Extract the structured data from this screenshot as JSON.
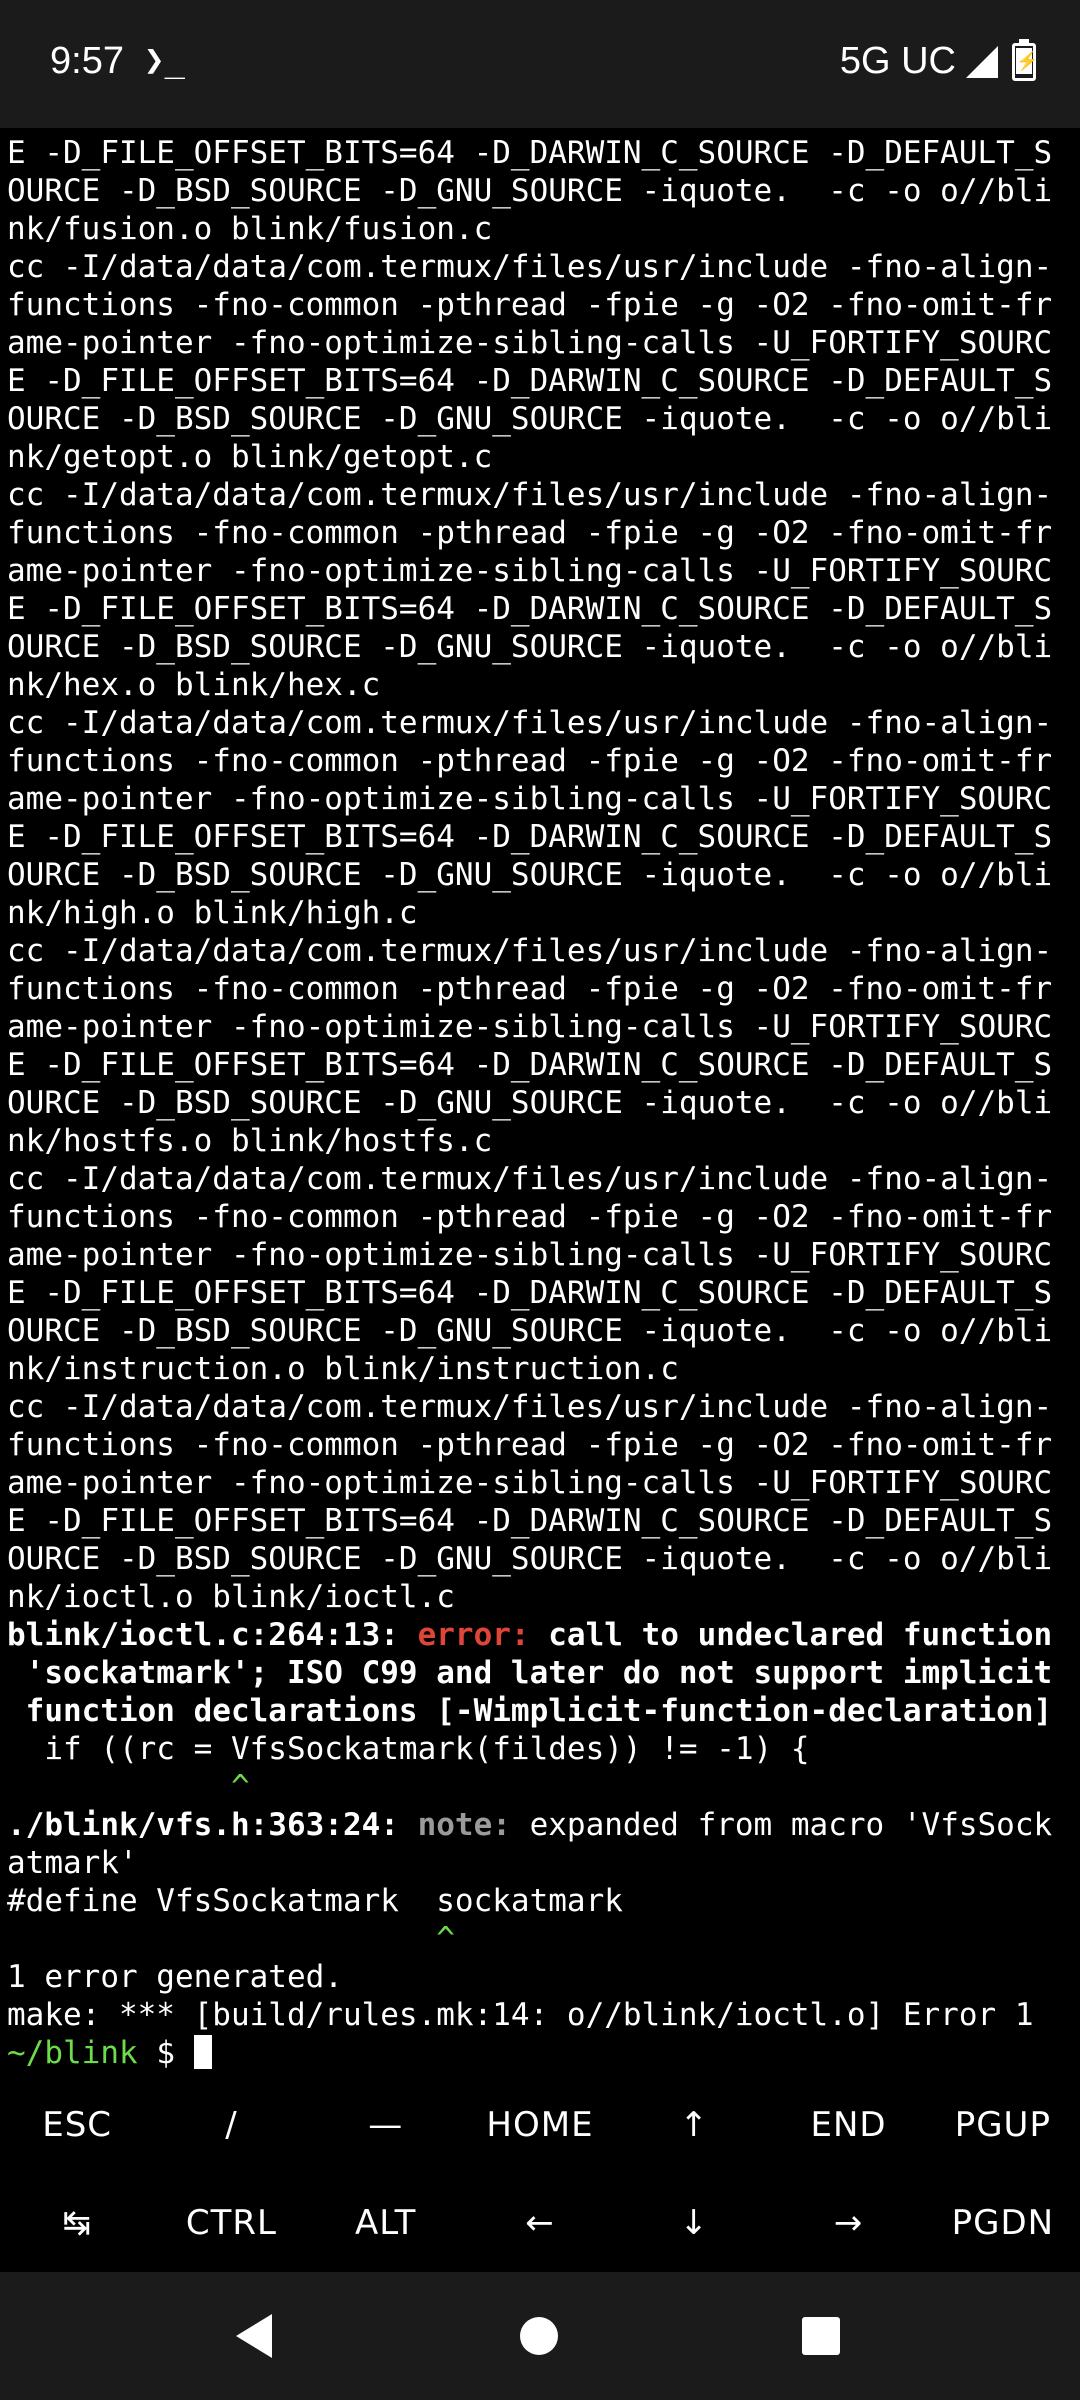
{
  "status_bar": {
    "time": "9:57",
    "term_glyph": "❯_",
    "network": "5G UC"
  },
  "terminal": {
    "lines": [
      {
        "parts": [
          {
            "t": "E -D_FILE_OFFSET_BITS=64 -D_DARWIN_C_SOURCE -D_DEFAULT_S"
          }
        ]
      },
      {
        "parts": [
          {
            "t": "OURCE -D_BSD_SOURCE -D_GNU_SOURCE -iquote.  -c -o o//bli"
          }
        ]
      },
      {
        "parts": [
          {
            "t": "nk/fusion.o blink/fusion.c"
          }
        ]
      },
      {
        "parts": [
          {
            "t": "cc -I/data/data/com.termux/files/usr/include -fno-align-"
          }
        ]
      },
      {
        "parts": [
          {
            "t": "functions -fno-common -pthread -fpie -g -O2 -fno-omit-fr"
          }
        ]
      },
      {
        "parts": [
          {
            "t": "ame-pointer -fno-optimize-sibling-calls -U_FORTIFY_SOURC"
          }
        ]
      },
      {
        "parts": [
          {
            "t": "E -D_FILE_OFFSET_BITS=64 -D_DARWIN_C_SOURCE -D_DEFAULT_S"
          }
        ]
      },
      {
        "parts": [
          {
            "t": "OURCE -D_BSD_SOURCE -D_GNU_SOURCE -iquote.  -c -o o//bli"
          }
        ]
      },
      {
        "parts": [
          {
            "t": "nk/getopt.o blink/getopt.c"
          }
        ]
      },
      {
        "parts": [
          {
            "t": "cc -I/data/data/com.termux/files/usr/include -fno-align-"
          }
        ]
      },
      {
        "parts": [
          {
            "t": "functions -fno-common -pthread -fpie -g -O2 -fno-omit-fr"
          }
        ]
      },
      {
        "parts": [
          {
            "t": "ame-pointer -fno-optimize-sibling-calls -U_FORTIFY_SOURC"
          }
        ]
      },
      {
        "parts": [
          {
            "t": "E -D_FILE_OFFSET_BITS=64 -D_DARWIN_C_SOURCE -D_DEFAULT_S"
          }
        ]
      },
      {
        "parts": [
          {
            "t": "OURCE -D_BSD_SOURCE -D_GNU_SOURCE -iquote.  -c -o o//bli"
          }
        ]
      },
      {
        "parts": [
          {
            "t": "nk/hex.o blink/hex.c"
          }
        ]
      },
      {
        "parts": [
          {
            "t": "cc -I/data/data/com.termux/files/usr/include -fno-align-"
          }
        ]
      },
      {
        "parts": [
          {
            "t": "functions -fno-common -pthread -fpie -g -O2 -fno-omit-fr"
          }
        ]
      },
      {
        "parts": [
          {
            "t": "ame-pointer -fno-optimize-sibling-calls -U_FORTIFY_SOURC"
          }
        ]
      },
      {
        "parts": [
          {
            "t": "E -D_FILE_OFFSET_BITS=64 -D_DARWIN_C_SOURCE -D_DEFAULT_S"
          }
        ]
      },
      {
        "parts": [
          {
            "t": "OURCE -D_BSD_SOURCE -D_GNU_SOURCE -iquote.  -c -o o//bli"
          }
        ]
      },
      {
        "parts": [
          {
            "t": "nk/high.o blink/high.c"
          }
        ]
      },
      {
        "parts": [
          {
            "t": "cc -I/data/data/com.termux/files/usr/include -fno-align-"
          }
        ]
      },
      {
        "parts": [
          {
            "t": "functions -fno-common -pthread -fpie -g -O2 -fno-omit-fr"
          }
        ]
      },
      {
        "parts": [
          {
            "t": "ame-pointer -fno-optimize-sibling-calls -U_FORTIFY_SOURC"
          }
        ]
      },
      {
        "parts": [
          {
            "t": "E -D_FILE_OFFSET_BITS=64 -D_DARWIN_C_SOURCE -D_DEFAULT_S"
          }
        ]
      },
      {
        "parts": [
          {
            "t": "OURCE -D_BSD_SOURCE -D_GNU_SOURCE -iquote.  -c -o o//bli"
          }
        ]
      },
      {
        "parts": [
          {
            "t": "nk/hostfs.o blink/hostfs.c"
          }
        ]
      },
      {
        "parts": [
          {
            "t": "cc -I/data/data/com.termux/files/usr/include -fno-align-"
          }
        ]
      },
      {
        "parts": [
          {
            "t": "functions -fno-common -pthread -fpie -g -O2 -fno-omit-fr"
          }
        ]
      },
      {
        "parts": [
          {
            "t": "ame-pointer -fno-optimize-sibling-calls -U_FORTIFY_SOURC"
          }
        ]
      },
      {
        "parts": [
          {
            "t": "E -D_FILE_OFFSET_BITS=64 -D_DARWIN_C_SOURCE -D_DEFAULT_S"
          }
        ]
      },
      {
        "parts": [
          {
            "t": "OURCE -D_BSD_SOURCE -D_GNU_SOURCE -iquote.  -c -o o//bli"
          }
        ]
      },
      {
        "parts": [
          {
            "t": "nk/instruction.o blink/instruction.c"
          }
        ]
      },
      {
        "parts": [
          {
            "t": "cc -I/data/data/com.termux/files/usr/include -fno-align-"
          }
        ]
      },
      {
        "parts": [
          {
            "t": "functions -fno-common -pthread -fpie -g -O2 -fno-omit-fr"
          }
        ]
      },
      {
        "parts": [
          {
            "t": "ame-pointer -fno-optimize-sibling-calls -U_FORTIFY_SOURC"
          }
        ]
      },
      {
        "parts": [
          {
            "t": "E -D_FILE_OFFSET_BITS=64 -D_DARWIN_C_SOURCE -D_DEFAULT_S"
          }
        ]
      },
      {
        "parts": [
          {
            "t": "OURCE -D_BSD_SOURCE -D_GNU_SOURCE -iquote.  -c -o o//bli"
          }
        ]
      },
      {
        "parts": [
          {
            "t": "nk/ioctl.o blink/ioctl.c"
          }
        ]
      },
      {
        "parts": [
          {
            "t": "blink/ioctl.c:264:13: ",
            "c": "b"
          },
          {
            "t": "error: ",
            "c": "red"
          },
          {
            "t": "call to undeclared function",
            "c": "b"
          }
        ]
      },
      {
        "parts": [
          {
            "t": " 'sockatmark'; ISO C99 and later do not support implicit",
            "c": "b"
          }
        ]
      },
      {
        "parts": [
          {
            "t": " function declarations [-Wimplicit-function-declaration]",
            "c": "b"
          }
        ]
      },
      {
        "parts": [
          {
            "t": "  if ((rc = VfsSockatmark(fildes)) != -1) {"
          }
        ]
      },
      {
        "parts": [
          {
            "t": "            ^",
            "c": "caret"
          }
        ]
      },
      {
        "parts": [
          {
            "t": "./blink/vfs.h:363:24: ",
            "c": "b"
          },
          {
            "t": "note: ",
            "c": "gray"
          },
          {
            "t": "expanded from macro 'VfsSock"
          }
        ]
      },
      {
        "parts": [
          {
            "t": "atmark'"
          }
        ]
      },
      {
        "parts": [
          {
            "t": "#define VfsSockatmark  sockatmark"
          }
        ]
      },
      {
        "parts": [
          {
            "t": "                       ^",
            "c": "caret"
          }
        ]
      },
      {
        "parts": [
          {
            "t": "1 error generated."
          }
        ]
      },
      {
        "parts": [
          {
            "t": "make: *** [build/rules.mk:14: o//blink/ioctl.o] Error 1"
          }
        ]
      }
    ],
    "prompt_path": "~/blink",
    "prompt_symbol": " $ "
  },
  "extra_keys": {
    "row1": [
      "ESC",
      "/",
      "—",
      "HOME",
      "↑",
      "END",
      "PGUP"
    ],
    "row2": [
      "↹",
      "CTRL",
      "ALT",
      "←",
      "↓",
      "→",
      "PGDN"
    ]
  }
}
